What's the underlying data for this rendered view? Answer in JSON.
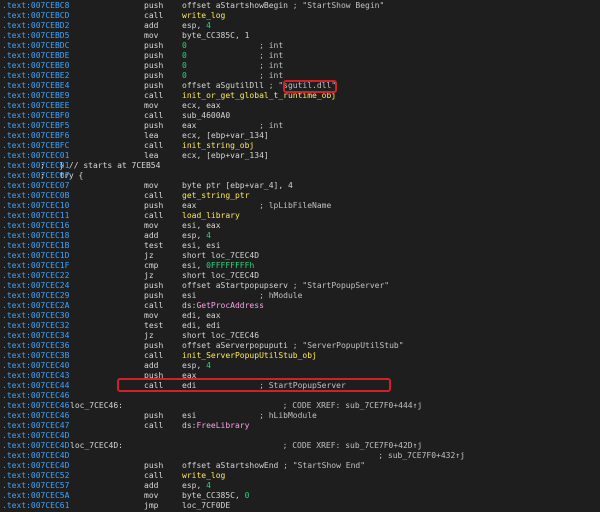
{
  "lines": [
    {
      "addr": ".text:007CEBC8",
      "mn": "push",
      "op": "offset aStartshowBegin",
      "cm": " ; \"StartShow Begin\""
    },
    {
      "addr": ".text:007CEBCD",
      "mn": "call",
      "fn": "write_log"
    },
    {
      "addr": ".text:007CEBD2",
      "mn": "add",
      "op": "esp, ",
      "num": "4"
    },
    {
      "addr": ".text:007CEBD5",
      "mn": "mov",
      "op": "byte_CC385C, 1"
    },
    {
      "addr": ".text:007CEBDC",
      "mn": "push",
      "num": "0",
      "cm": "               ; int"
    },
    {
      "addr": ".text:007CEBDE",
      "mn": "push",
      "num": "0",
      "cm": "               ; int"
    },
    {
      "addr": ".text:007CEBE0",
      "mn": "push",
      "num": "0",
      "cm": "               ; int"
    },
    {
      "addr": ".text:007CEBE2",
      "mn": "push",
      "num": "0",
      "cm": "               ; int"
    },
    {
      "addr": ".text:007CEBE4",
      "mn": "push",
      "op": "offset aSgutilDll",
      "cm": " ; \"sgutil.dll\""
    },
    {
      "addr": ".text:007CEBE9",
      "mn": "call",
      "fn": "init_or_get_global_t_runtime_obj"
    },
    {
      "addr": ".text:007CEBEE",
      "mn": "mov",
      "op": "ecx, eax"
    },
    {
      "addr": ".text:007CEBF0",
      "mn": "call",
      "op": "sub_4600A0"
    },
    {
      "addr": ".text:007CEBF5",
      "mn": "push",
      "op": "eax",
      "cm": "             ; int"
    },
    {
      "addr": ".text:007CEBF6",
      "mn": "lea",
      "op": "ecx, [ebp+var_134]"
    },
    {
      "addr": ".text:007CEBFC",
      "mn": "call",
      "fn": "init_string_obj"
    },
    {
      "addr": ".text:007CEC01",
      "mn": "lea",
      "op": "ecx, [ebp+var_134]"
    },
    {
      "addr": ".text:007CEC01",
      "cl": ";   } // starts at 7CEB54"
    },
    {
      "addr": ".text:007CEC07",
      "cl": ";   try {"
    },
    {
      "addr": ".text:007CEC07",
      "mn": "mov",
      "op": "byte ptr [ebp+var_4], 4"
    },
    {
      "addr": ".text:007CEC0B",
      "mn": "call",
      "fn": "get_string_ptr"
    },
    {
      "addr": ".text:007CEC10",
      "mn": "push",
      "op": "eax",
      "cm": "             ; lpLibFileName"
    },
    {
      "addr": ".text:007CEC11",
      "mn": "call",
      "fn": "load_library"
    },
    {
      "addr": ".text:007CEC16",
      "mn": "mov",
      "op": "esi, eax"
    },
    {
      "addr": ".text:007CEC18",
      "mn": "add",
      "op": "esp, ",
      "num": "4"
    },
    {
      "addr": ".text:007CEC1B",
      "mn": "test",
      "op": "esi, esi"
    },
    {
      "addr": ".text:007CEC1D",
      "mn": "jz",
      "op": "short loc_7CEC4D"
    },
    {
      "addr": ".text:007CEC1F",
      "mn": "cmp",
      "op": "esi, ",
      "num": "0FFFFFFFFh"
    },
    {
      "addr": ".text:007CEC22",
      "mn": "jz",
      "op": "short loc_7CEC4D"
    },
    {
      "addr": ".text:007CEC24",
      "mn": "push",
      "op": "offset aStartpopupserv",
      "cm": " ; \"StartPopupServer\""
    },
    {
      "addr": ".text:007CEC29",
      "mn": "push",
      "op": "esi",
      "cm": "             ; hModule"
    },
    {
      "addr": ".text:007CEC2A",
      "mn": "call",
      "op": "ds:",
      "imp": "GetProcAddress"
    },
    {
      "addr": ".text:007CEC30",
      "mn": "mov",
      "op": "edi, eax"
    },
    {
      "addr": ".text:007CEC32",
      "mn": "test",
      "op": "edi, edi"
    },
    {
      "addr": ".text:007CEC34",
      "mn": "jz",
      "op": "short loc_7CEC46"
    },
    {
      "addr": ".text:007CEC36",
      "mn": "push",
      "op": "offset aServerpopuputi",
      "cm": " ; \"ServerPopupUtilStub\""
    },
    {
      "addr": ".text:007CEC3B",
      "mn": "call",
      "fn": "init_ServerPopupUtilStub_obj"
    },
    {
      "addr": ".text:007CEC40",
      "mn": "add",
      "op": "esp, ",
      "num": "4"
    },
    {
      "addr": ".text:007CEC43",
      "mn": "push",
      "op": "eax"
    },
    {
      "addr": ".text:007CEC44",
      "mn": "call",
      "op": "edi",
      "cm": "             ; StartPopupServer"
    },
    {
      "addr": ".text:007CEC46"
    },
    {
      "addr": ".text:007CEC46",
      "lb": "loc_7CEC46:",
      "cm": "                                   ; CODE XREF: sub_7CE7F0+444↑j"
    },
    {
      "addr": ".text:007CEC46",
      "mn": "push",
      "op": "esi",
      "cm": "             ; hLibModule"
    },
    {
      "addr": ".text:007CEC47",
      "mn": "call",
      "op": "ds:",
      "imp": "FreeLibrary"
    },
    {
      "addr": ".text:007CEC4D"
    },
    {
      "addr": ".text:007CEC4D",
      "lb": "loc_7CEC4D:",
      "cm": "                                   ; CODE XREF: sub_7CE7F0+42D↑j"
    },
    {
      "addr": ".text:007CEC4D",
      "cm": "                                                                ; sub_7CE7F0+432↑j"
    },
    {
      "addr": ".text:007CEC4D",
      "mn": "push",
      "op": "offset aStartshowEnd",
      "cm": " ; \"StartShow End\""
    },
    {
      "addr": ".text:007CEC52",
      "mn": "call",
      "fn": "write_log"
    },
    {
      "addr": ".text:007CEC57",
      "mn": "add",
      "op": "esp, ",
      "num": "4"
    },
    {
      "addr": ".text:007CEC5A",
      "mn": "mov",
      "op": "byte_CC385C, ",
      "num": "0"
    },
    {
      "addr": ".text:007CEC61",
      "mn": "jmp",
      "op": "loc_7CF0DE"
    }
  ],
  "colors": {
    "background": "#1e1e1e",
    "address": "#3fa4ff",
    "function": "#ffe95a",
    "number": "#2fd27a",
    "import": "#ff9fe9",
    "highlight": "#d0202a"
  }
}
